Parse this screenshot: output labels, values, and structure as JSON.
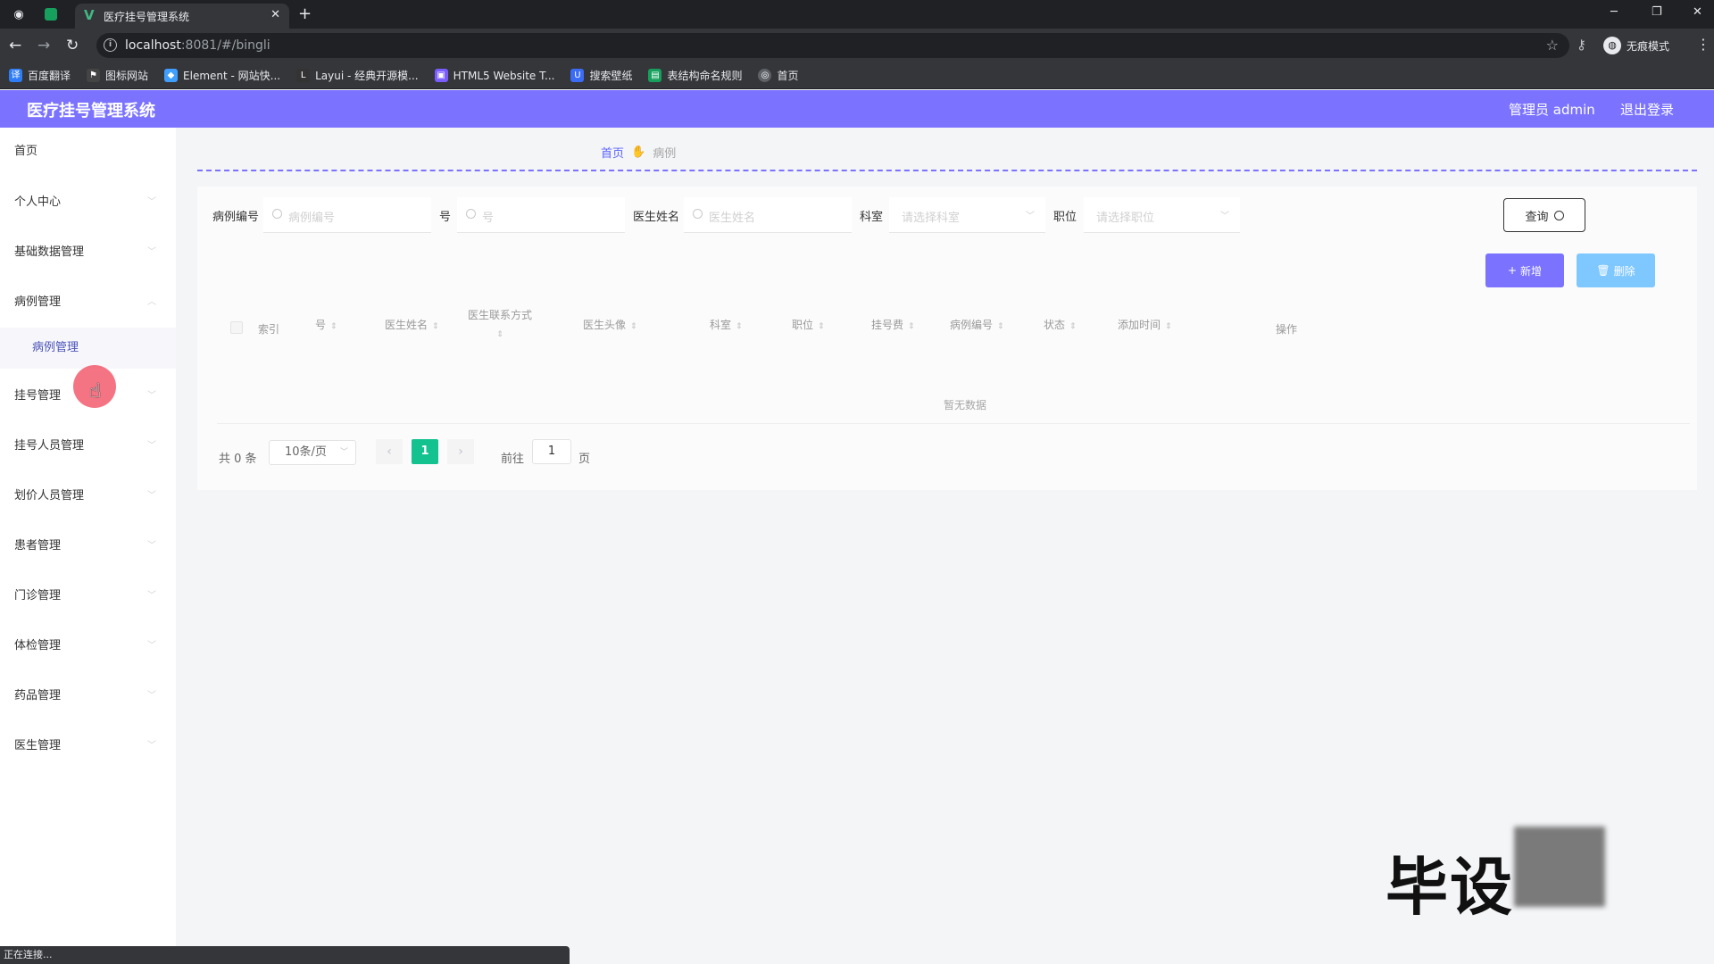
{
  "browser": {
    "tab_title": "医疗挂号管理系统",
    "url_host": "localhost",
    "url_rest": ":8081/#/bingli",
    "incognito_label": "无痕模式",
    "bookmarks": [
      {
        "label": "百度翻译",
        "color": "#2f7df6"
      },
      {
        "label": "图标网站",
        "color": "#444444"
      },
      {
        "label": "Element - 网站快...",
        "color": "#409eff"
      },
      {
        "label": "Layui - 经典开源模...",
        "color": "#333333"
      },
      {
        "label": "HTML5 Website T...",
        "color": "#7a5cff"
      },
      {
        "label": "搜索壁纸",
        "color": "#3b6cf5"
      },
      {
        "label": "表结构命名规则",
        "color": "#17a05d"
      },
      {
        "label": "首页",
        "color": "#5f6368"
      }
    ],
    "status_text": "正在连接..."
  },
  "header": {
    "title": "医疗挂号管理系统",
    "user": "管理员 admin",
    "logout": "退出登录"
  },
  "sidebar": {
    "items": [
      {
        "label": "首页"
      },
      {
        "label": "个人中心"
      },
      {
        "label": "基础数据管理"
      },
      {
        "label": "病例管理"
      },
      {
        "label": "病例管理"
      },
      {
        "label": "挂号管理"
      },
      {
        "label": "挂号人员管理"
      },
      {
        "label": "划价人员管理"
      },
      {
        "label": "患者管理"
      },
      {
        "label": "门诊管理"
      },
      {
        "label": "体检管理"
      },
      {
        "label": "药品管理"
      },
      {
        "label": "医生管理"
      }
    ]
  },
  "breadcrumb": {
    "home": "首页",
    "current": "病例"
  },
  "filters": [
    {
      "label": "病例编号",
      "placeholder": "病例编号"
    },
    {
      "label": "号",
      "placeholder": "号"
    },
    {
      "label": "医生姓名",
      "placeholder": "医生姓名"
    },
    {
      "label": "科室",
      "placeholder": "请选择科室"
    },
    {
      "label": "职位",
      "placeholder": "请选择职位"
    }
  ],
  "buttons": {
    "query": "查询",
    "add": "新增",
    "delete": "删除"
  },
  "table": {
    "columns": [
      "索引",
      "号",
      "医生姓名",
      "医生联系方式",
      "医生头像",
      "科室",
      "职位",
      "挂号费",
      "病例编号",
      "状态",
      "添加时间",
      "操作"
    ],
    "empty_text": "暂无数据"
  },
  "pagination": {
    "total": "共 0 条",
    "page_size": "10条/页",
    "current_page": "1",
    "goto_label": "前往",
    "goto_value": "1",
    "page_unit": "页"
  },
  "watermark": "毕设"
}
